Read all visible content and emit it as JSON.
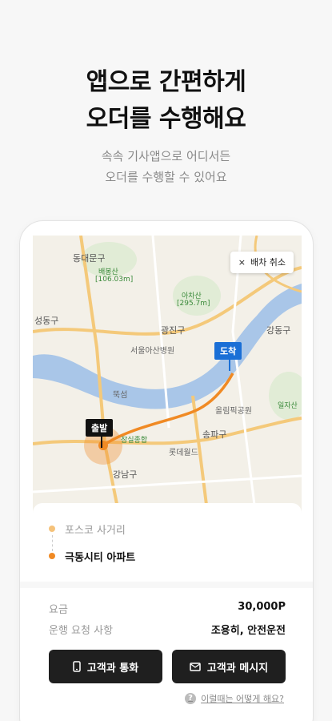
{
  "header": {
    "title_line1": "앱으로 간편하게",
    "title_line2": "오더를 수행해요",
    "subtitle_line1": "속속 기사앱으로 어디서든",
    "subtitle_line2": "오더를 수행할 수 있어요"
  },
  "map": {
    "cancel_label": "배차 취소",
    "cancel_icon": "×",
    "arrive_label": "도착",
    "depart_label": "출발",
    "labels": {
      "dongdaemun": "동대문구",
      "baebongsan": "배봉산",
      "baebongsan_height": "[106.03m]",
      "achasan": "아차산",
      "achasan_height": "[295.7m]",
      "seongdong": "성동구",
      "gwangjin": "광진구",
      "gangdong": "강동구",
      "seoul_hospital": "서울아산병원",
      "songpa": "송파구",
      "gangnam": "강남구",
      "lotteworld": "롯데월드",
      "olympic": "올림픽공원",
      "ilja": "일자산",
      "jamsil": "잠실종합",
      "ttukseom": "뚝섬",
      "gangnam_area": "강남구"
    }
  },
  "route": {
    "from": "포스코 사거리",
    "to": "극동시티 아파트"
  },
  "info": {
    "fare_label": "요금",
    "fare_value": "30,000P",
    "request_label": "운행 요청 사항",
    "request_value": "조용히, 안전운전"
  },
  "actions": {
    "call_label": "고객과 통화",
    "message_label": "고객과 메시지",
    "help_label": "이럴때는 어떻게 해요?"
  },
  "colors": {
    "route_orange": "#f08a24",
    "arrive_blue": "#1a6fd6",
    "river": "#a9c6e8"
  }
}
